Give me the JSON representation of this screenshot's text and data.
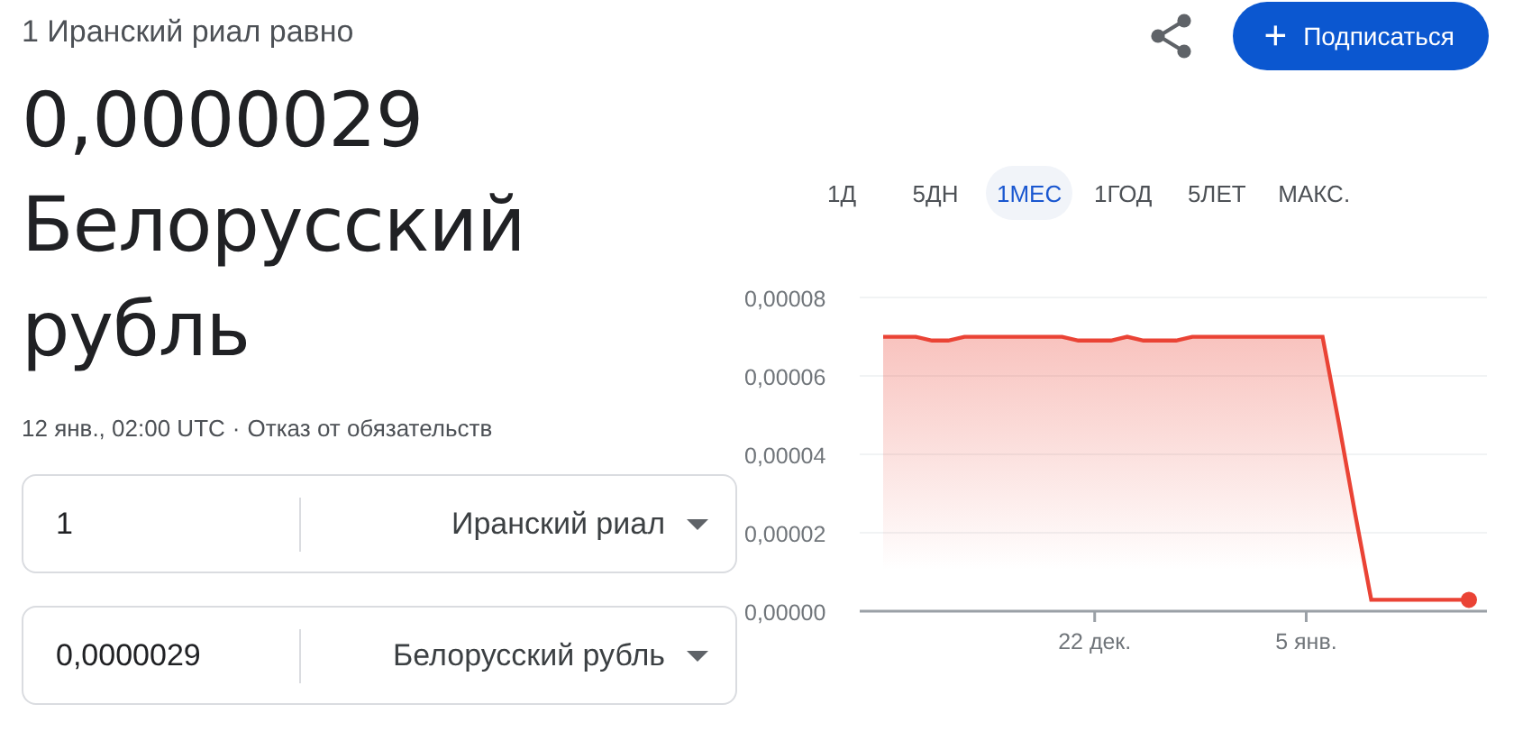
{
  "header": {
    "subtitle": "1 Иранский риал равно",
    "value": "0,0000029",
    "currency_line_1": "Белорусский",
    "currency_line_2": "рубль",
    "timestamp": "12 янв., 02:00 UTC",
    "separator": "·",
    "disclaimer_link": "Отказ от обязательств"
  },
  "subscribe_button": {
    "icon": "+",
    "label": "Подписаться"
  },
  "converter": [
    {
      "amount": "1",
      "currency": "Иранский риал"
    },
    {
      "amount": "0,0000029",
      "currency": "Белорусский рубль"
    }
  ],
  "range_tabs": [
    {
      "label": "1Д",
      "selected": false
    },
    {
      "label": "5ДН",
      "selected": false
    },
    {
      "label": "1МЕС",
      "selected": true
    },
    {
      "label": "1ГОД",
      "selected": false
    },
    {
      "label": "5ЛЕТ",
      "selected": false
    },
    {
      "label": "МАКС.",
      "selected": false
    }
  ],
  "chart": {
    "chart_data": {
      "type": "area",
      "categories": [
        null,
        null,
        null,
        null,
        null,
        null,
        null,
        null,
        null,
        null,
        null,
        null,
        null,
        "22 дек.",
        null,
        null,
        null,
        null,
        null,
        null,
        null,
        null,
        null,
        null,
        null,
        null,
        "5 янв.",
        null,
        null,
        null,
        null,
        null,
        null,
        null,
        null,
        null,
        null
      ],
      "series": [
        {
          "color": "#ea4335",
          "values": [
            7e-05,
            7e-05,
            7e-05,
            6.9e-05,
            6.9e-05,
            7e-05,
            7e-05,
            7e-05,
            7e-05,
            7e-05,
            7e-05,
            7e-05,
            6.9e-05,
            6.9e-05,
            6.9e-05,
            7e-05,
            6.9e-05,
            6.9e-05,
            6.9e-05,
            7e-05,
            7e-05,
            7e-05,
            7e-05,
            7e-05,
            7e-05,
            7e-05,
            7e-05,
            7e-05,
            4.8e-05,
            2.5e-05,
            2.9e-06,
            2.9e-06,
            2.9e-06,
            2.9e-06,
            2.9e-06,
            2.9e-06,
            2.9e-06
          ]
        }
      ],
      "ylim": [
        0,
        8e-05
      ],
      "grid": true,
      "yticks": [
        {
          "value": 0,
          "label": "0,00000"
        },
        {
          "value": 2e-05,
          "label": "0,00002"
        },
        {
          "value": 4e-05,
          "label": "0,00004"
        },
        {
          "value": 6e-05,
          "label": "0,00006"
        },
        {
          "value": 8e-05,
          "label": "0,00008"
        }
      ]
    }
  }
}
